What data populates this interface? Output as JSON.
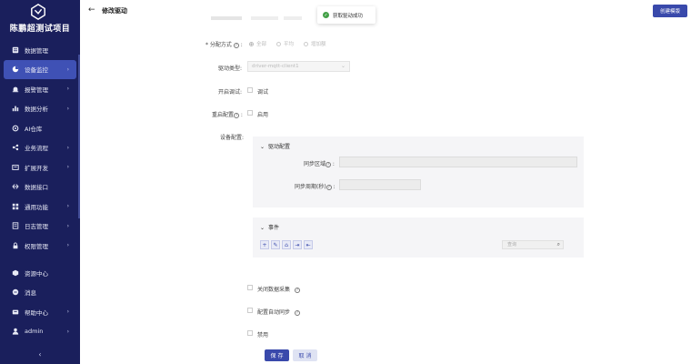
{
  "app": {
    "title": "陈鹏超测试项目"
  },
  "sidebar": {
    "items": [
      {
        "label": "数据管理",
        "icon": "database-icon",
        "arrow": ""
      },
      {
        "label": "设备监控",
        "icon": "monitor-icon",
        "arrow": "›",
        "active": true
      },
      {
        "label": "报警管理",
        "icon": "alarm-icon",
        "arrow": "›"
      },
      {
        "label": "数据分析",
        "icon": "chart-icon",
        "arrow": "›"
      },
      {
        "label": "AI仓库",
        "icon": "ai-icon",
        "arrow": ""
      },
      {
        "label": "业务流程",
        "icon": "flow-icon",
        "arrow": "›"
      },
      {
        "label": "扩展开发",
        "icon": "extend-icon",
        "arrow": "›"
      },
      {
        "label": "数据接口",
        "icon": "api-icon",
        "arrow": ""
      },
      {
        "label": "通用功能",
        "icon": "grid-icon",
        "arrow": "›"
      },
      {
        "label": "日志管理",
        "icon": "log-icon",
        "arrow": "›"
      },
      {
        "label": "权限管理",
        "icon": "lock-icon",
        "arrow": "›"
      }
    ],
    "bottom": [
      {
        "label": "资源中心",
        "icon": "cube-icon",
        "arrow": ""
      },
      {
        "label": "消息",
        "icon": "message-icon",
        "arrow": ""
      },
      {
        "label": "帮助中心",
        "icon": "help-icon",
        "arrow": "›"
      },
      {
        "label": "admin",
        "icon": "user-icon",
        "arrow": "›"
      }
    ],
    "collapse": "‹"
  },
  "header": {
    "back": "←",
    "title": "修改驱动",
    "create_button": "创建模版"
  },
  "toast": {
    "text": "获取驱动成功"
  },
  "form": {
    "assign_label": "* 分配方式",
    "assign_options": [
      "全部",
      "平均",
      "增加额"
    ],
    "driver_type_label": "驱动类型:",
    "driver_type_value": "driver-mqtt-client1",
    "debug_label": "开启调试:",
    "debug_option": "调试",
    "reboot_label": "重启配置",
    "reboot_option": "启用",
    "device_config_label": "设备配置:",
    "driver_config_title": "驱动配置",
    "sync_area_label": "同步区域",
    "sync_period_label": "同步周期(秒)",
    "events_title": "事件",
    "query_placeholder": "查询",
    "close_collect": "关闭数据采集",
    "auto_sync": "配置自动同步",
    "disable": "禁用",
    "save": "保 存",
    "cancel": "取 消"
  }
}
